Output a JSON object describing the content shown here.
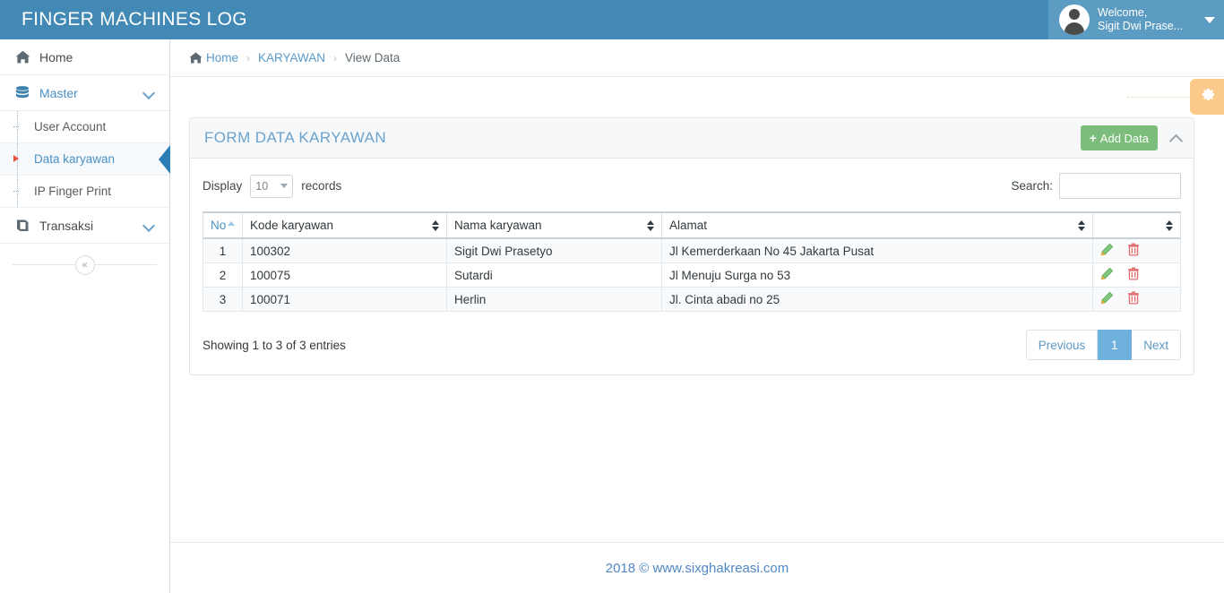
{
  "header": {
    "brand": "FINGER MACHINES LOG",
    "user": {
      "greeting": "Welcome,",
      "name": "Sigit Dwi Prase...",
      "avatar_icon": "user-avatar-icon",
      "caret_icon": "chevron-down-icon"
    },
    "bg_color": "#4389b5"
  },
  "sidebar": {
    "items": [
      {
        "label": "Home",
        "icon": "home-icon"
      },
      {
        "label": "Master",
        "icon": "database-stack-icon",
        "chevron": "chevron-down-icon"
      },
      {
        "label": "Transaksi",
        "icon": "book-icon",
        "chevron": "chevron-down-icon"
      }
    ],
    "sub_items": [
      {
        "label": "User Account",
        "active": false
      },
      {
        "label": "Data karyawan",
        "active": true
      },
      {
        "label": "IP Finger Print",
        "active": false
      }
    ],
    "collapse_label": "«",
    "active_color": "#4a90c4"
  },
  "breadcrumb": {
    "home_icon": "home-icon",
    "items": [
      "Home",
      "KARYAWAN",
      "View Data"
    ],
    "separator": "›"
  },
  "content": {
    "settings_icon": "gear-icon",
    "panel": {
      "title": "FORM DATA KARYAWAN",
      "add_label": "Add Data",
      "add_icon": "plus-icon",
      "add_color": "#7cbd7c",
      "collapse_icon": "chevron-up-icon"
    },
    "datatable": {
      "display_label": "Display",
      "records_label": "records",
      "page_length": "10",
      "search_label": "Search:",
      "search_value": "",
      "search_placeholder": "",
      "columns": [
        {
          "label": "No",
          "sort": "asc"
        },
        {
          "label": "Kode karyawan",
          "sort": "none"
        },
        {
          "label": "Nama karyawan",
          "sort": "none"
        },
        {
          "label": "Alamat",
          "sort": "none"
        },
        {
          "label": "",
          "sort": "none"
        }
      ],
      "rows": [
        {
          "no": "1",
          "kode": "100302",
          "nama": "Sigit Dwi Prasetyo",
          "alamat": "Jl Kemerderkaan No 45 Jakarta Pusat",
          "edit_icon": "pencil-icon",
          "delete_icon": "trash-icon"
        },
        {
          "no": "2",
          "kode": "100075",
          "nama": "Sutardi",
          "alamat": "Jl Menuju Surga no 53",
          "edit_icon": "pencil-icon",
          "delete_icon": "trash-icon"
        },
        {
          "no": "3",
          "kode": "100071",
          "nama": "Herlin",
          "alamat": "Jl. Cinta abadi no 25",
          "edit_icon": "pencil-icon",
          "delete_icon": "trash-icon"
        }
      ],
      "info": "Showing 1 to 3 of 3 entries",
      "pagination": {
        "previous": "Previous",
        "pages": [
          "1"
        ],
        "next": "Next",
        "active_page": "1",
        "active_color": "#6fb1dd"
      }
    }
  },
  "footer": {
    "text": "2018 © www.sixghakreasi.com",
    "color": "#4f87c7"
  }
}
